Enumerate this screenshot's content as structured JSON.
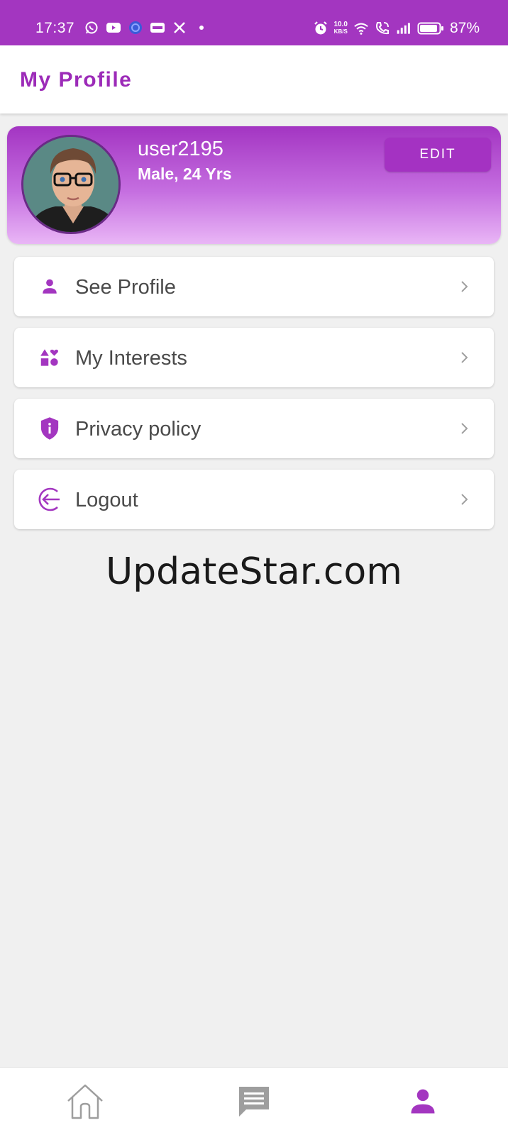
{
  "status_bar": {
    "time": "17:37",
    "net_speed_value": "10.0",
    "net_speed_unit": "KB/S",
    "battery": "87%",
    "notification_icons": [
      "whatsapp-icon",
      "youtube-icon",
      "browser-icon",
      "paytm-icon",
      "x-icon",
      "dot-icon"
    ],
    "system_icons": [
      "alarm-icon",
      "wifi-icon",
      "wifi-calling-icon",
      "signal-icon",
      "battery-icon"
    ]
  },
  "header": {
    "title": "My Profile"
  },
  "profile": {
    "username": "user2195",
    "details": "Male,  24 Yrs",
    "edit_label": "EDIT"
  },
  "menu": {
    "items": [
      {
        "label": "See Profile",
        "icon": "person-icon"
      },
      {
        "label": "My Interests",
        "icon": "interests-icon"
      },
      {
        "label": "Privacy policy",
        "icon": "shield-icon"
      },
      {
        "label": "Logout",
        "icon": "logout-icon"
      }
    ]
  },
  "watermark": "UpdateStar.com",
  "bottom_nav": {
    "items": [
      "home-icon",
      "chat-icon",
      "profile-icon"
    ],
    "active": "profile-icon"
  },
  "colors": {
    "primary": "#a336c0",
    "status_bar": "#a336c0",
    "background": "#f0f0f0",
    "card_gradient_top": "#a335c2",
    "card_gradient_bottom": "#e9b6f6",
    "inactive_icon": "#9e9e9e"
  }
}
